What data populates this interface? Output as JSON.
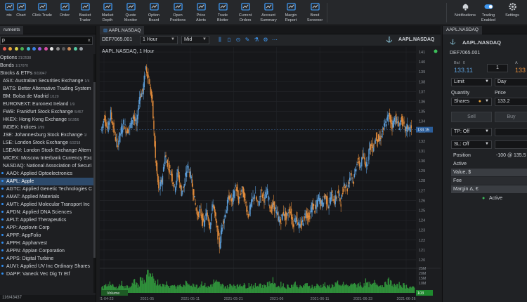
{
  "toolbar": {
    "items": [
      {
        "label": "nts",
        "icon": "accounts-icon"
      },
      {
        "label": "Chart",
        "icon": "chart-icon"
      },
      {
        "label": "Click-Trade",
        "icon": "click-trade-icon"
      },
      {
        "label": "Order",
        "icon": "order-icon"
      },
      {
        "label": "Basket\nTrader",
        "icon": "basket-icon"
      },
      {
        "label": "Market\nDepth",
        "icon": "market-depth-icon"
      },
      {
        "label": "Quote\nMonitor",
        "icon": "quote-monitor-icon"
      },
      {
        "label": "Option\nBoard",
        "icon": "option-board-icon"
      },
      {
        "label": "Open\nPositions",
        "icon": "open-positions-icon"
      },
      {
        "label": "Price\nAlerts",
        "icon": "price-alerts-icon"
      },
      {
        "label": "Trade\nBlotter",
        "icon": "trade-blotter-icon"
      },
      {
        "label": "Current\nOrders",
        "icon": "current-orders-icon"
      },
      {
        "label": "Account\nSummary",
        "icon": "account-summary-icon"
      },
      {
        "label": "Margin\nReport",
        "icon": "margin-report-icon"
      },
      {
        "label": "Bond\nScreener",
        "icon": "bond-screener-icon"
      }
    ],
    "right_items": [
      {
        "label": "Notifications",
        "icon": "bell-icon"
      },
      {
        "label": "Trading\nEnabled",
        "icon": "toggle-icon"
      },
      {
        "label": "Settings",
        "icon": "gear-icon"
      }
    ]
  },
  "left_panel": {
    "tab": "ruments",
    "search_value": "p",
    "dot_colors": [
      "#e05a4f",
      "#e8a33a",
      "#d9d24a",
      "#4caf50",
      "#3fb6c9",
      "#3b7fe0",
      "#a25ad9",
      "#d94fa6",
      "#e6e6e6",
      "#8a8a8a",
      "#5a5a5a",
      "#c78a5a",
      "#55c9a0",
      "#9aa0a6"
    ],
    "groups": [
      {
        "label": "Options",
        "count": "21/2538"
      },
      {
        "label": "Bonds",
        "count": "1/17070"
      },
      {
        "label": "Stocks & ETFs",
        "count": "8/19947"
      }
    ],
    "exchanges": [
      {
        "label": "ASX: Australian Securities Exchange",
        "count": "1/4"
      },
      {
        "label": "BATS: Better Alternative Trading System",
        "count": ""
      },
      {
        "label": "BM: Bolsa de Madrid",
        "count": "1/120"
      },
      {
        "label": "EURONEXT: Euronext Ireland",
        "count": "1/9"
      },
      {
        "label": "FWB: Frankfurt Stock Exchange",
        "count": "5/457"
      },
      {
        "label": "HKEX: Hong Kong Exchange",
        "count": "5/1956"
      },
      {
        "label": "INDEX: Indices",
        "count": "2/99"
      },
      {
        "label": "JSE: Johannesburg  Stock Exchange",
        "count": "1/"
      },
      {
        "label": "LSE: London Stock Exchange",
        "count": "6/3218"
      },
      {
        "label": "LSEAIM: London Stock Exchange Altern",
        "count": ""
      },
      {
        "label": "MICEX: Moscow Interbank Currency Exc",
        "count": ""
      },
      {
        "label": "NASDAQ: National Association of Securi",
        "count": ""
      }
    ],
    "instruments": [
      "AAOI: Applied Optoelectronics",
      "AAPL: Apple",
      "AGTC: Applied Genetic Technologies C",
      "AMAT: Applied Materials",
      "AMTI: Applied Molecular Transport Inc",
      "APDN: Applied DNA Sciences",
      "APLT: Applied Therapeutics",
      "APP: Applovin Corp",
      "APPF: AppFolio",
      "APPH: Appharvest",
      "APPN: Appian Corporation",
      "APPS: Digital Turbine",
      "AUVI: Applied UV Inc Ordinary Shares",
      "DAPP: Vaneck Vec Dig Tr Etf"
    ],
    "selected": "AAPL: Apple",
    "status": "116/43437"
  },
  "chart": {
    "tab": "AAPL.NASDAQ",
    "account": "DEF7065.001",
    "symbol": "AAPL.NASDAQ",
    "interval_select": "1 Hour",
    "price_type_select": "Mid",
    "chart_title": "AAPL.NASDAQ, 1 Hour",
    "last_price": "133.15",
    "volume_label": "Volume",
    "volume_value": "103",
    "colors": {
      "up": "#5b9bd5",
      "down": "#e08a3a",
      "volume": "#2f8f3a",
      "badge": "#2a5d9a"
    }
  },
  "chart_data": {
    "type": "candlestick",
    "title": "AAPL.NASDAQ, 1 Hour",
    "y_ticks": [
      141,
      140,
      139,
      138,
      137,
      136,
      135,
      134,
      133,
      132,
      131,
      130,
      129,
      128,
      127,
      126,
      125,
      124,
      123,
      122,
      121,
      120
    ],
    "x_ticks": [
      "2021-04-23",
      "2021-05",
      "2021-05-11",
      "2021-05-21",
      "2021-06",
      "2021-06-11",
      "2021-06-23",
      "2021-06-26"
    ],
    "volume_ticks": [
      "25M",
      "20M",
      "15M",
      "10M"
    ],
    "ylim": [
      119.5,
      141.5
    ],
    "close_path": [
      133.0,
      134.5,
      133.2,
      134.8,
      133.0,
      131.5,
      132.8,
      133.8,
      133.0,
      133.4,
      134.6,
      133.5,
      136.5,
      137.0,
      139.5,
      138.0,
      135.8,
      130.2,
      127.0,
      128.0,
      130.5,
      129.5,
      128.6,
      127.2,
      129.0,
      126.8,
      127.6,
      129.5,
      128.5,
      126.5,
      124.5,
      125.0,
      123.5,
      124.8,
      123.5,
      125.8,
      123.5,
      121.5,
      123.8,
      124.8,
      126.5,
      125.8,
      127.5,
      126.0,
      127.2,
      126.0,
      124.5,
      125.7,
      126.7,
      125.5,
      126.8,
      126.2,
      126.8,
      125.0,
      125.6,
      124.5,
      123.8,
      124.8,
      124.2,
      125.2,
      123.6,
      124.4,
      123.2,
      123.8,
      124.8,
      124.2,
      125.5,
      125.0,
      126.3,
      125.6,
      126.5,
      125.5,
      126.6,
      125.9,
      126.8,
      125.8,
      127.8,
      127.2,
      128.8,
      128.0,
      130.0,
      129.5,
      130.5,
      129.5,
      131.5,
      131.3,
      132.5,
      132.0,
      133.0,
      133.8,
      134.6,
      133.6,
      134.4,
      133.5,
      134.2,
      133.1,
      133.4,
      133.15
    ],
    "volumes_m": [
      7,
      9,
      12,
      8,
      6,
      9,
      11,
      7,
      8,
      10,
      13,
      9,
      16,
      14,
      22,
      18,
      15,
      13,
      11,
      9,
      12,
      8,
      10,
      7,
      9,
      8,
      11,
      12,
      9,
      10,
      8,
      12,
      9,
      7,
      10,
      13,
      11,
      9,
      8,
      7,
      9,
      10,
      8,
      11,
      9,
      8,
      10,
      7,
      9,
      11,
      8,
      10,
      12,
      14,
      9,
      8,
      10,
      7,
      8,
      9,
      11,
      8,
      7,
      9,
      10,
      8,
      7,
      9,
      8,
      10,
      7,
      8,
      9,
      11,
      8,
      10,
      9,
      8,
      12,
      9,
      11,
      8,
      13,
      10,
      9,
      12,
      11,
      9,
      10,
      14,
      12,
      9,
      8,
      10,
      9,
      8,
      7,
      6
    ]
  },
  "order_panel": {
    "tab": "AAPL.NASDAQ",
    "symbol": "AAPL.NASDAQ",
    "account": "DEF7065.001",
    "bid_label": "Bid",
    "bid_price": "133.11",
    "ask_label": "A",
    "ask_price": "133",
    "quantity_box": "1",
    "order_type": "Limit",
    "duration": "Day",
    "quantity_label": "Quantity",
    "price_label": "Price",
    "quantity_unit": "Shares",
    "price_value": "133.2",
    "sell_label": "Sell",
    "buy_label": "Buy",
    "tp_label": "TP: Off",
    "sl_label": "SL: Off",
    "position_label": "Position",
    "position_value": "-100 @ 135.5",
    "active_label": "Active",
    "value_label": "Value, $",
    "fee_label": "Fee",
    "margin_label": "Margin Δ, €",
    "status": "Active",
    "colors": {
      "bid": "#5b9bd5",
      "ask": "#e08a3a",
      "active": "#3cbf5a"
    }
  }
}
